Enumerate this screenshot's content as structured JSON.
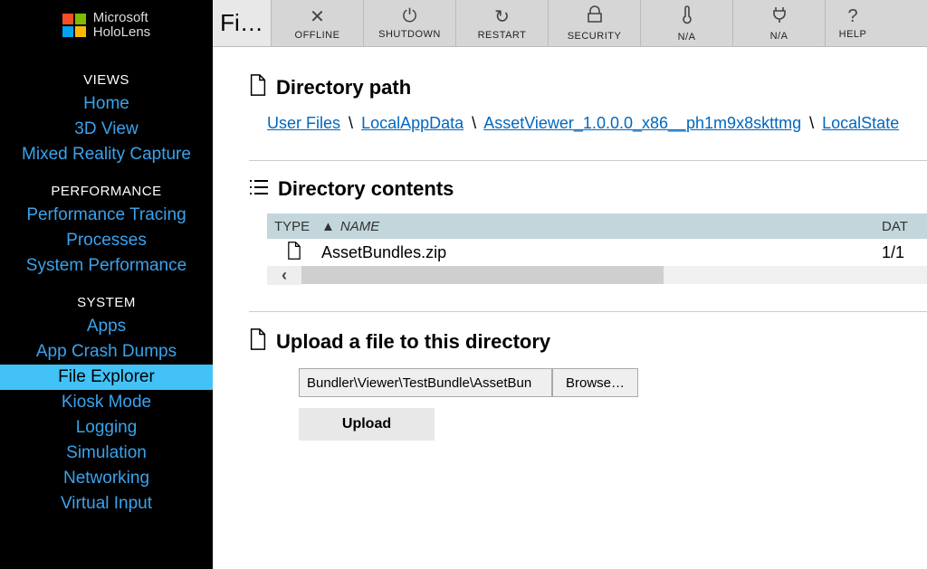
{
  "brand": {
    "line1": "Microsoft",
    "line2": "HoloLens"
  },
  "sidebar": {
    "sections": [
      {
        "title": "VIEWS",
        "items": [
          "Home",
          "3D View",
          "Mixed Reality Capture"
        ]
      },
      {
        "title": "PERFORMANCE",
        "items": [
          "Performance Tracing",
          "Processes",
          "System Performance"
        ]
      },
      {
        "title": "SYSTEM",
        "items": [
          "Apps",
          "App Crash Dumps",
          "File Explorer",
          "Kiosk Mode",
          "Logging",
          "Simulation",
          "Networking",
          "Virtual Input"
        ]
      }
    ],
    "active": "File Explorer"
  },
  "toolbar": {
    "title": "Fi…",
    "buttons": [
      {
        "icon": "✕",
        "label": "OFFLINE",
        "name": "offline-button"
      },
      {
        "icon": "⏻",
        "label": "SHUTDOWN",
        "name": "shutdown-button"
      },
      {
        "icon": "↻",
        "label": "RESTART",
        "name": "restart-button"
      },
      {
        "icon": "lock",
        "label": "SECURITY",
        "name": "security-button"
      },
      {
        "icon": "therm",
        "label": "N/A",
        "name": "temperature-button"
      },
      {
        "icon": "plug",
        "label": "N/A",
        "name": "power-button"
      },
      {
        "icon": "?",
        "label": "HELP",
        "name": "help-button"
      }
    ]
  },
  "directory_path": {
    "title": "Directory path",
    "items": [
      "User Files",
      "LocalAppData",
      "AssetViewer_1.0.0.0_x86__ph1m9x8skttmg",
      "LocalState"
    ],
    "sep": "\\"
  },
  "directory_contents": {
    "title": "Directory contents",
    "columns": {
      "type": "TYPE",
      "name": "NAME",
      "date": "DAT"
    },
    "rows": [
      {
        "name": "AssetBundles.zip",
        "date": "1/1"
      }
    ]
  },
  "upload": {
    "title": "Upload a file to this directory",
    "input_value": "Bundler\\Viewer\\TestBundle\\AssetBun",
    "browse_label": "Browse…",
    "upload_label": "Upload"
  }
}
